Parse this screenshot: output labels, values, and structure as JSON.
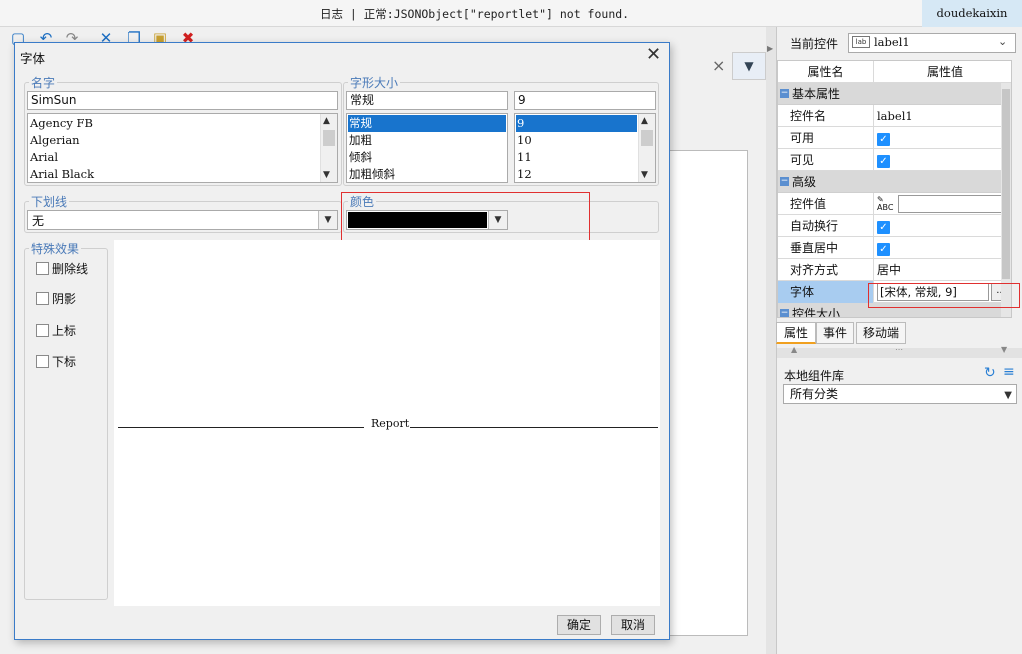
{
  "logbar": {
    "text": "日志 | 正常:JSONObject[\"reportlet\"] not found.",
    "user": "doudekaixin"
  },
  "toolbar": {
    "icons": [
      "save-icon",
      "undo-icon",
      "redo-icon",
      "cut-icon",
      "copy-icon",
      "paste-icon",
      "delete-icon"
    ],
    "colors": {
      "accent": "#1e6fc2",
      "delete": "#d02020"
    }
  },
  "right_panel": {
    "current_control_label": "当前控件",
    "current_control_icon": "lab",
    "current_control_value": "label1",
    "table_header": {
      "name": "属性名",
      "value": "属性值"
    },
    "groups": {
      "basic": "基本属性",
      "advanced": "高级",
      "control_size": "控件大小"
    },
    "rows": {
      "control_name": {
        "name": "控件名",
        "value": "label1"
      },
      "enabled": {
        "name": "可用"
      },
      "visible": {
        "name": "可见"
      },
      "control_value": {
        "name": "控件值"
      },
      "auto_wrap": {
        "name": "自动换行"
      },
      "vertical_center": {
        "name": "垂直居中"
      },
      "align": {
        "name": "对齐方式",
        "value": "居中"
      },
      "font": {
        "name": "字体",
        "value": "[宋体, 常规, 9]",
        "button": "..."
      }
    },
    "tabs": [
      "属性",
      "事件",
      "移动端"
    ],
    "library_label": "本地组件库",
    "library_select": "所有分类"
  },
  "dialog": {
    "title": "字体",
    "name_group": {
      "legend": "名字",
      "value": "SimSun",
      "fonts": [
        "Agency FB",
        "Algerian",
        "Arial",
        "Arial Black"
      ]
    },
    "style_group": {
      "legend": "字形大小",
      "style_value": "常规",
      "styles": [
        "常规",
        "加粗",
        "倾斜",
        "加粗倾斜"
      ],
      "size_value": "9",
      "sizes": [
        "9",
        "10",
        "11",
        "12"
      ]
    },
    "underline_group": {
      "legend": "下划线",
      "value": "无"
    },
    "color_group": {
      "legend": "颜色",
      "value": "#000000"
    },
    "effects_group": {
      "legend": "特殊效果",
      "items": [
        "删除线",
        "阴影",
        "上标",
        "下标"
      ]
    },
    "preview_text": "Report",
    "ok": "确定",
    "cancel": "取消"
  }
}
